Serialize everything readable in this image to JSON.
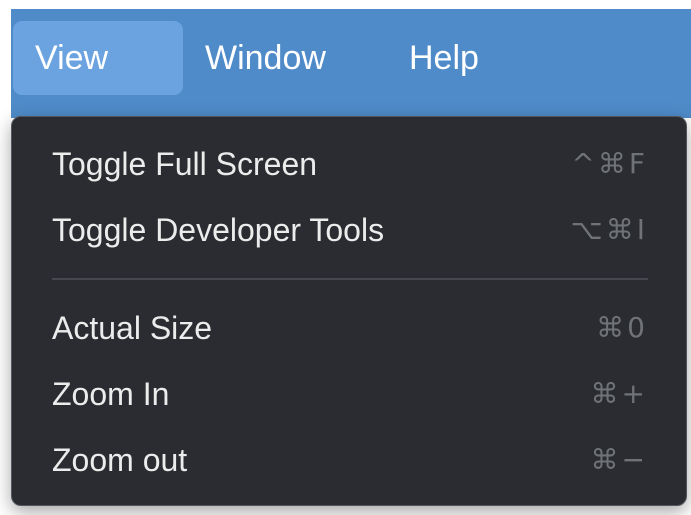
{
  "menubar": {
    "items": [
      {
        "label": "View",
        "active": true
      },
      {
        "label": "Window",
        "active": false
      },
      {
        "label": "Help",
        "active": false
      }
    ]
  },
  "dropdown": {
    "items": [
      {
        "label": "Toggle Full Screen",
        "shortcut": "^⌘F"
      },
      {
        "label": "Toggle Developer Tools",
        "shortcut": "⌥⌘I"
      },
      {
        "label": "Actual Size",
        "shortcut": "⌘0"
      },
      {
        "label": "Zoom In",
        "shortcut": "⌘+"
      },
      {
        "label": "Zoom out",
        "shortcut": "⌘−"
      }
    ]
  },
  "colors": {
    "menubar_bg": "#4f8bc9",
    "menubar_active": "#6aa3df",
    "dropdown_bg": "#2a2c31",
    "item_text": "#ececec",
    "shortcut_text": "#6f7277"
  }
}
